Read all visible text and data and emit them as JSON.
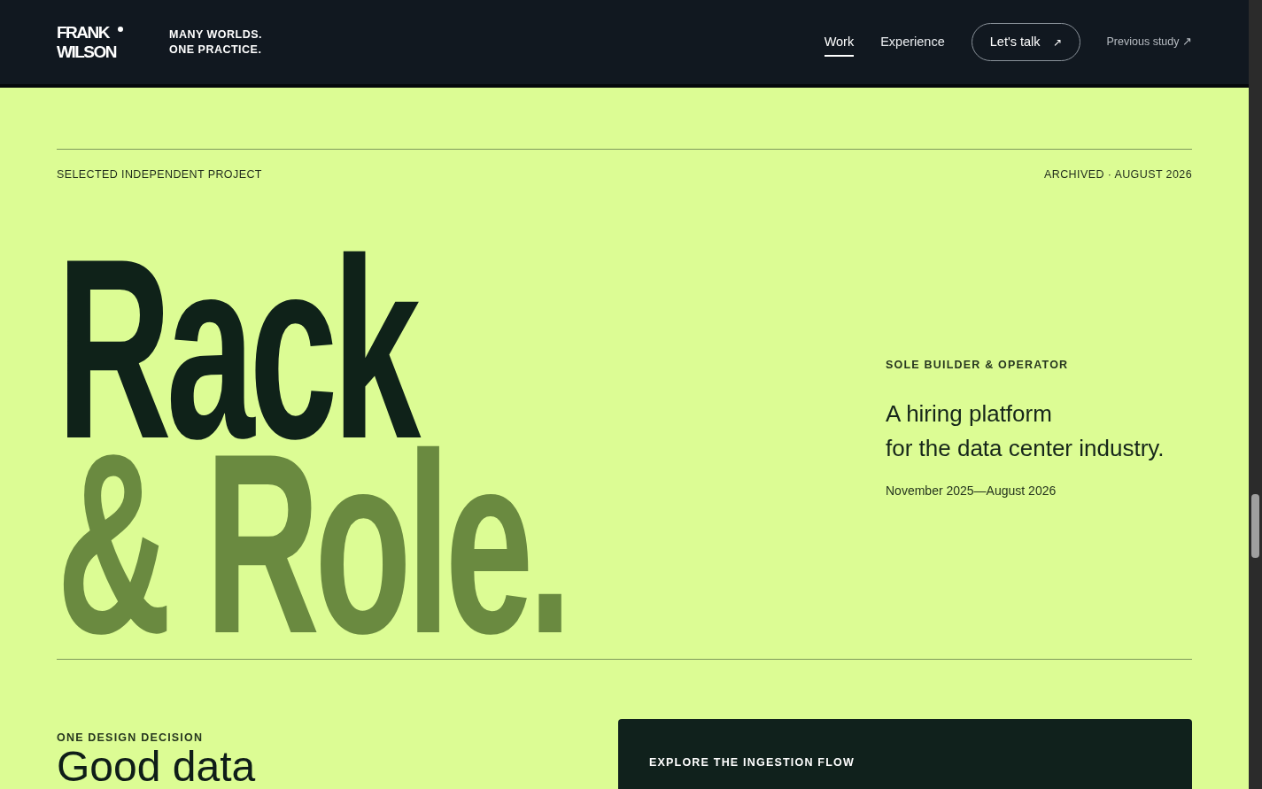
{
  "header": {
    "logo_lines": [
      "FRANK",
      "WILSON"
    ],
    "tagline_lines": [
      "MANY WORLDS.",
      "ONE PRACTICE."
    ],
    "nav": [
      {
        "label": "Work",
        "selected": true
      },
      {
        "label": "Experience",
        "selected": false
      }
    ],
    "cta": {
      "label": "Let's talk",
      "icon": "↗"
    },
    "previous_link": "Previous study ↗"
  },
  "hero": {
    "eyebrow": "SELECTED INDEPENDENT PROJECT",
    "meta": "ARCHIVED · AUGUST 2026",
    "title_lines": [
      {
        "text": "Rack",
        "kind": "dark"
      },
      {
        "text": "& Role.",
        "kind": "muted"
      }
    ],
    "role": "SOLE BUILDER & OPERATOR",
    "summary_lines": [
      "A hiring platform",
      "for the data center industry."
    ],
    "dates": "November 2025—August 2026"
  },
  "decision": {
    "eyebrow": "ONE DESIGN DECISION",
    "heading": "Good data",
    "panel_label": "EXPLORE THE INGESTION FLOW"
  }
}
